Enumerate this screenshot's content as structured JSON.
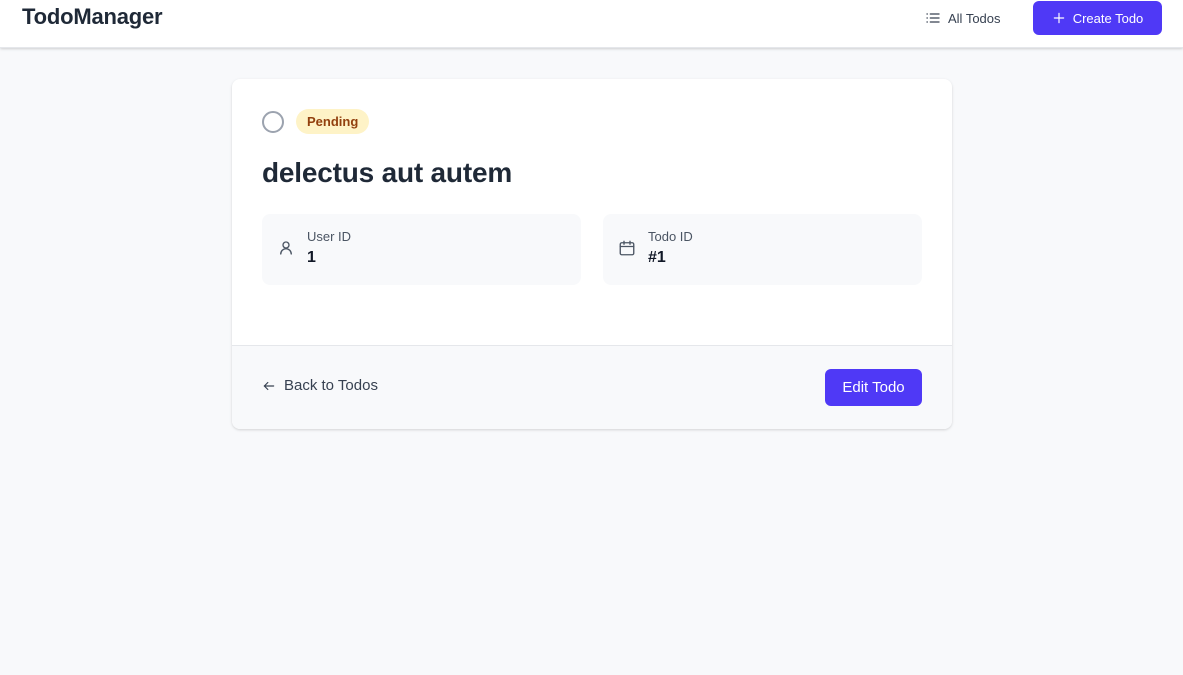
{
  "header": {
    "brand": "TodoManager",
    "nav_all_todos": "All Todos",
    "create_todo": "Create Todo"
  },
  "todo": {
    "status_badge": "Pending",
    "title": "delectus aut autem",
    "user_id_label": "User ID",
    "user_id_value": "1",
    "todo_id_label": "Todo ID",
    "todo_id_value": "#1"
  },
  "footer": {
    "back_label": "Back to Todos",
    "edit_label": "Edit Todo"
  },
  "colors": {
    "primary": "#4f39f6",
    "badge_bg": "#fef3c7",
    "badge_text": "#92400e",
    "page_bg": "#f8f9fb"
  },
  "icons": [
    "list-icon",
    "plus-icon",
    "user-icon",
    "calendar-icon",
    "arrow-left-icon",
    "status-circle-icon"
  ]
}
